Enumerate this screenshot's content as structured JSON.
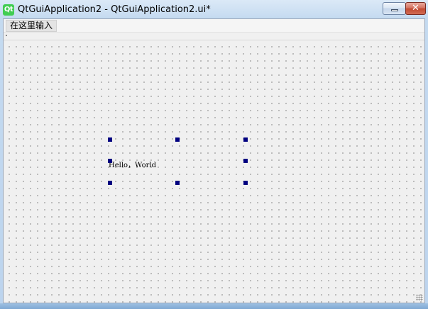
{
  "window": {
    "title": "QtGuiApplication2 - QtGuiApplication2.ui*",
    "app_icon_label": "Qt",
    "close_glyph": "✕"
  },
  "menubar": {
    "placeholder_item": "在这里输入"
  },
  "form": {
    "label_text": "Hello，World"
  },
  "colors": {
    "selection_handle": "#000080",
    "canvas_background": "#f0f0f0",
    "qt_brand": "#41cd52"
  }
}
